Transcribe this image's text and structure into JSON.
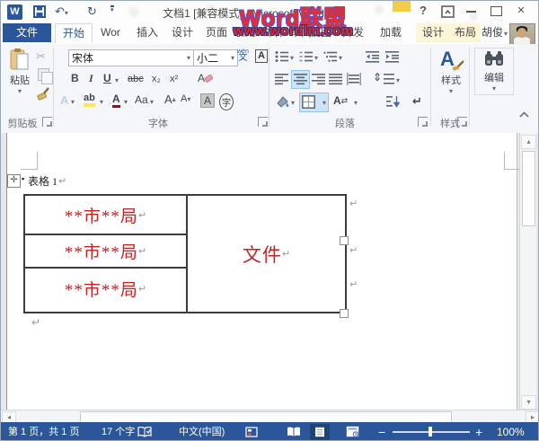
{
  "colors": {
    "accent": "#2b579a",
    "doc_red": "#c42323",
    "watermark_red": "#e62e2e"
  },
  "icons": {
    "caret_down": "▾",
    "caret_up": "▴",
    "scissors": "✂",
    "undo": "↶",
    "redo": "↻",
    "return_mark": "↵",
    "scroll_left": "◂",
    "scroll_right": "▸",
    "scroll_up": "▴",
    "scroll_down": "▾",
    "close": "×",
    "help": "?",
    "anchor": "▪",
    "move": "✛",
    "swap": "⇄",
    "updown": "⇕",
    "zoom_out": "−",
    "zoom_in": "+",
    "collapse": "∧"
  },
  "titlebar": {
    "title": "文档1 [兼容模式] - Microsoft Word"
  },
  "watermark": {
    "line1": "Word联盟",
    "line2": "www.wordlm.com"
  },
  "tabs": [
    {
      "label": "文件"
    },
    {
      "label": "开始"
    },
    {
      "label": "Wor"
    },
    {
      "label": "插入"
    },
    {
      "label": "设计"
    },
    {
      "label": "页面"
    },
    {
      "label": "引用"
    },
    {
      "label": "邮件"
    },
    {
      "label": "审阅"
    },
    {
      "label": "视图"
    },
    {
      "label": "开发"
    },
    {
      "label": "加载"
    },
    {
      "label": "设计"
    },
    {
      "label": "布局"
    }
  ],
  "user": {
    "name": "胡俊"
  },
  "ribbon": {
    "clipboard": {
      "group_label": "剪贴板",
      "paste_label": "粘贴"
    },
    "font": {
      "group_label": "字体",
      "font_name": "宋体",
      "font_size": "小二",
      "phonetic_top": "wén",
      "phonetic_bottom": "文",
      "char_border": "A",
      "bold": "B",
      "italic": "I",
      "underline": "U",
      "strike": "abc",
      "subscript": "x₂",
      "superscript": "x²",
      "effects": "A",
      "highlight": "ab",
      "font_color": "A",
      "change_case": "Aa",
      "grow": "A",
      "shrink": "A",
      "char_shading": "A",
      "enclose": "字"
    },
    "paragraph": {
      "group_label": "段落",
      "asian_char": "A"
    },
    "styles": {
      "group_label": "样式",
      "button_label": "样式",
      "big_a": "A"
    },
    "editing": {
      "button_label": "编辑"
    }
  },
  "document": {
    "caption": "表格 1",
    "table": {
      "rows": [
        "**市**局",
        "**市**局",
        "**市**局"
      ],
      "merged_cell": "文件"
    }
  },
  "status_bar": {
    "page_info": "第 1 页，共 1 页",
    "word_count": "17 个字",
    "language": "中文(中国)",
    "zoom_level": "100%"
  }
}
